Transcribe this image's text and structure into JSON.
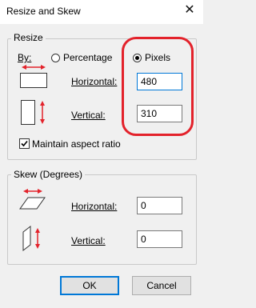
{
  "window": {
    "title": "Resize and Skew",
    "close_glyph": "✕"
  },
  "resize": {
    "legend": "Resize",
    "by_label": "By:",
    "percentage_label": "Percentage",
    "pixels_label": "Pixels",
    "horizontal_label": "Horizontal:",
    "horizontal_value": "480",
    "vertical_label": "Vertical:",
    "vertical_value": "310",
    "maintain_aspect_label": "Maintain aspect ratio",
    "maintain_aspect_checked": true
  },
  "skew": {
    "legend": "Skew (Degrees)",
    "horizontal_label": "Horizontal:",
    "horizontal_value": "0",
    "vertical_label": "Vertical:",
    "vertical_value": "0"
  },
  "buttons": {
    "ok": "OK",
    "cancel": "Cancel"
  },
  "colors": {
    "accent": "#0078d7",
    "arrow_red": "#e3222b",
    "highlight_red": "#e3222b"
  },
  "icons": [
    "close-icon",
    "resize-horizontal-icon",
    "resize-vertical-icon",
    "skew-horizontal-icon",
    "skew-vertical-icon",
    "checkmark-icon"
  ]
}
